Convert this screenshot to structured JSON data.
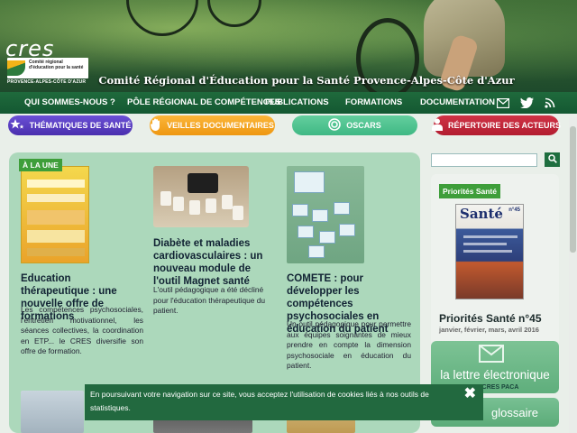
{
  "header": {
    "logo_word": "cres",
    "logo_subtitle": "Comité régional d'éducation pour la santé",
    "logo_region": "PROVENCE-ALPES-CÔTE D'AZUR",
    "site_title": "Comité Régional d'Éducation pour la Santé Provence-Alpes-Côte d'Azur"
  },
  "nav": {
    "items": [
      "QUI SOMMES-NOUS ?",
      "PÔLE RÉGIONAL DE COMPÉTENCES",
      "PUBLICATIONS",
      "FORMATIONS",
      "DOCUMENTATION"
    ],
    "icons": [
      "email-icon",
      "twitter-icon",
      "rss-icon"
    ]
  },
  "pills": [
    {
      "label": "THÉMATIQUES DE SANTÉ",
      "icon": "stars-icon",
      "color": "#5a3fc4"
    },
    {
      "label": "VEILLES DOCUMENTAIRES",
      "icon": "hand-icon",
      "color": "#f5a623"
    },
    {
      "label": "OSCARS",
      "icon": "target-icon",
      "color": "#4cc28e"
    },
    {
      "label": "RÉPERTOIRE DES ACTEURS",
      "icon": "person-icon",
      "color": "#c0283b"
    }
  ],
  "main": {
    "badge": "À LA UNE",
    "articles": [
      {
        "title": "Education thérapeutique : une nouvelle offre de formations",
        "text": "Les compétences psychosociales, l'entretien motivationnel, les séances collectives, la coordination en ETP... le CRES diversifie son offre de formation."
      },
      {
        "title": "Diabète et maladies cardiovasculaires : un nouveau module de l'outil Magnet santé",
        "text": "L'outil pédagogique a été décliné pour l'éducation thérapeutique du patient."
      },
      {
        "title": "COMETE : pour développer les compétences psychosociales en éducation du patient",
        "text": "Un outil pédagogique pour permettre aux équipes soignantes de mieux prendre en compte la dimension psychosociale en éducation du patient."
      }
    ]
  },
  "search": {
    "placeholder": ""
  },
  "sidebar": {
    "label": "Priorités Santé",
    "magazine_title": "Santé",
    "magazine_number": "n°45",
    "issue_title": "Priorités Santé n°45",
    "issue_date": "janvier, février, mars, avril 2016",
    "newsletter_line1": "la lettre électronique",
    "newsletter_line2": "DU CRES PACA",
    "glossary": "glossaire"
  },
  "cookie": {
    "text": "En poursuivant votre navigation sur ce site, vous acceptez l'utilisation de cookies liés à nos outils de statistiques.",
    "close": "✖"
  }
}
